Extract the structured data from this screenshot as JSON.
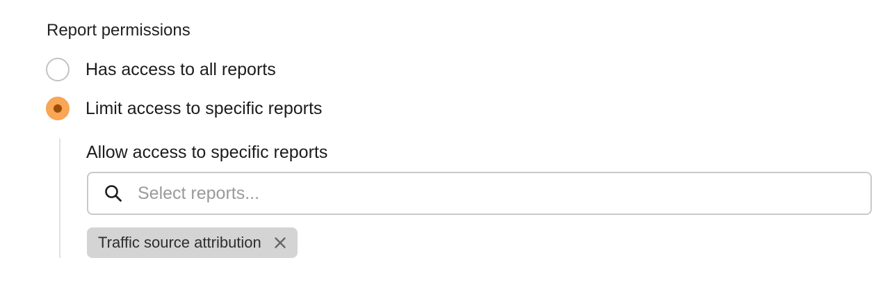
{
  "report_permissions": {
    "title": "Report permissions",
    "options": [
      {
        "label": "Has access to all reports",
        "selected": false
      },
      {
        "label": "Limit access to specific reports",
        "selected": true
      }
    ],
    "accent_color": "#f9a656",
    "accent_dot_color": "#9a4e08"
  },
  "specific_reports": {
    "title": "Allow access to specific reports",
    "search": {
      "icon": "search-icon",
      "placeholder": "Select reports...",
      "value": ""
    },
    "selected_reports": [
      {
        "label": "Traffic source attribution",
        "remove_icon": "close-icon"
      }
    ]
  }
}
